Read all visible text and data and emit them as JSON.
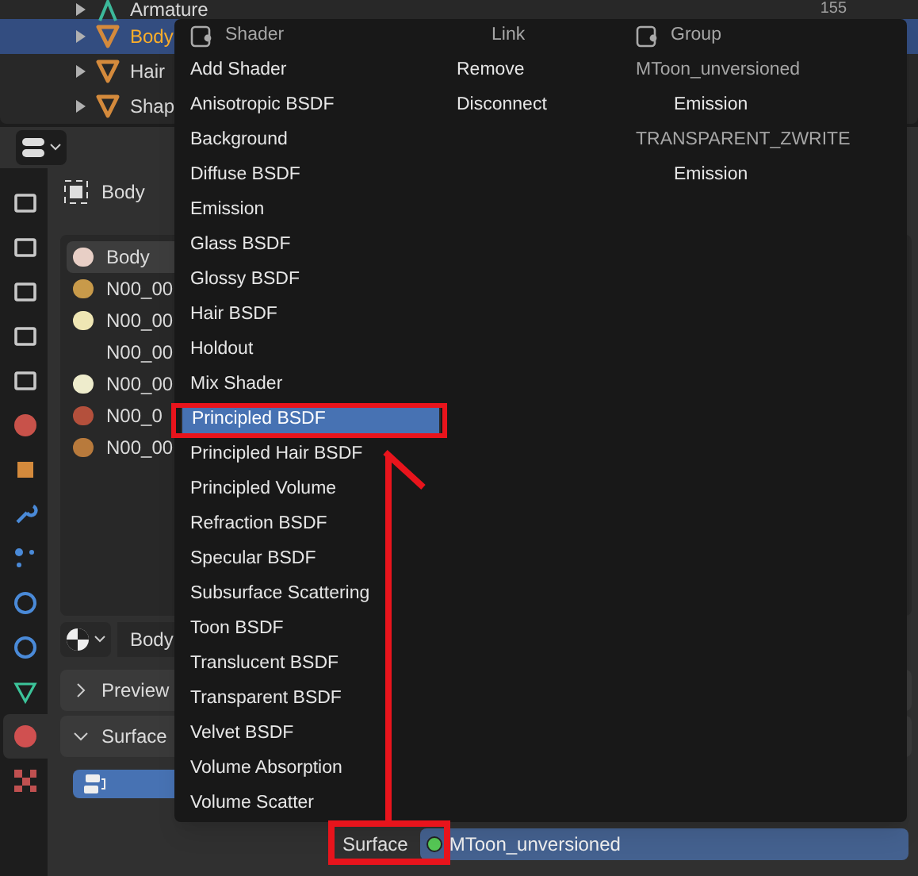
{
  "outliner": {
    "rows": [
      {
        "label": "Armature",
        "count": "155",
        "kind": "armature",
        "selected": false
      },
      {
        "label": "Body",
        "kind": "mesh",
        "selected": true
      },
      {
        "label": "Hair",
        "kind": "mesh",
        "selected": false
      },
      {
        "label": "Shap",
        "kind": "mesh",
        "selected": false
      }
    ]
  },
  "properties": {
    "breadcrumb": "Body",
    "materials": [
      {
        "label": "Body",
        "selected": true,
        "color": "#e8cfc6"
      },
      {
        "label": "N00_00",
        "selected": false,
        "color": "#c89a4a"
      },
      {
        "label": "N00_00",
        "selected": false,
        "color": "#efe6b4"
      },
      {
        "label": "N00_00",
        "selected": false
      },
      {
        "label": "N00_00",
        "selected": false,
        "color": "#eeeccc"
      },
      {
        "label": "N00_0",
        "selected": false,
        "color": "#b4503c"
      },
      {
        "label": "N00_00",
        "selected": false,
        "color": "#b87a3c"
      }
    ],
    "material_name": "Body",
    "panels": [
      {
        "label": "Preview",
        "expanded": false
      },
      {
        "label": "Surface",
        "expanded": true
      }
    ],
    "surface": {
      "label": "Surface",
      "value": "MToon_unversioned"
    }
  },
  "menu": {
    "columns": [
      {
        "title": "Shader",
        "icon": true,
        "items": [
          {
            "label": "Add Shader",
            "selected": false
          },
          {
            "label": "Anisotropic BSDF",
            "selected": false
          },
          {
            "label": "Background",
            "selected": false
          },
          {
            "label": "Diffuse BSDF",
            "selected": false
          },
          {
            "label": "Emission",
            "selected": false
          },
          {
            "label": "Glass BSDF",
            "selected": false
          },
          {
            "label": "Glossy BSDF",
            "selected": false
          },
          {
            "label": "Hair BSDF",
            "selected": false
          },
          {
            "label": "Holdout",
            "selected": false
          },
          {
            "label": "Mix Shader",
            "selected": false
          },
          {
            "label": "Principled BSDF",
            "selected": true
          },
          {
            "label": "Principled Hair BSDF",
            "selected": false
          },
          {
            "label": "Principled Volume",
            "selected": false
          },
          {
            "label": "Refraction BSDF",
            "selected": false
          },
          {
            "label": "Specular BSDF",
            "selected": false
          },
          {
            "label": "Subsurface Scattering",
            "selected": false
          },
          {
            "label": "Toon BSDF",
            "selected": false
          },
          {
            "label": "Translucent BSDF",
            "selected": false
          },
          {
            "label": "Transparent BSDF",
            "selected": false
          },
          {
            "label": "Velvet BSDF",
            "selected": false
          },
          {
            "label": "Volume Absorption",
            "selected": false
          },
          {
            "label": "Volume Scatter",
            "selected": false
          }
        ]
      },
      {
        "title": "Link",
        "icon": false,
        "items": [
          {
            "label": "Remove",
            "kind": "item"
          },
          {
            "label": "Disconnect",
            "kind": "item"
          }
        ]
      },
      {
        "title": "Group",
        "icon": true,
        "items": [
          {
            "label": "MToon_unversioned",
            "kind": "group"
          },
          {
            "label": "Emission",
            "kind": "node"
          },
          {
            "label": "TRANSPARENT_ZWRITE",
            "kind": "group"
          },
          {
            "label": "Emission",
            "kind": "node"
          }
        ]
      }
    ]
  }
}
